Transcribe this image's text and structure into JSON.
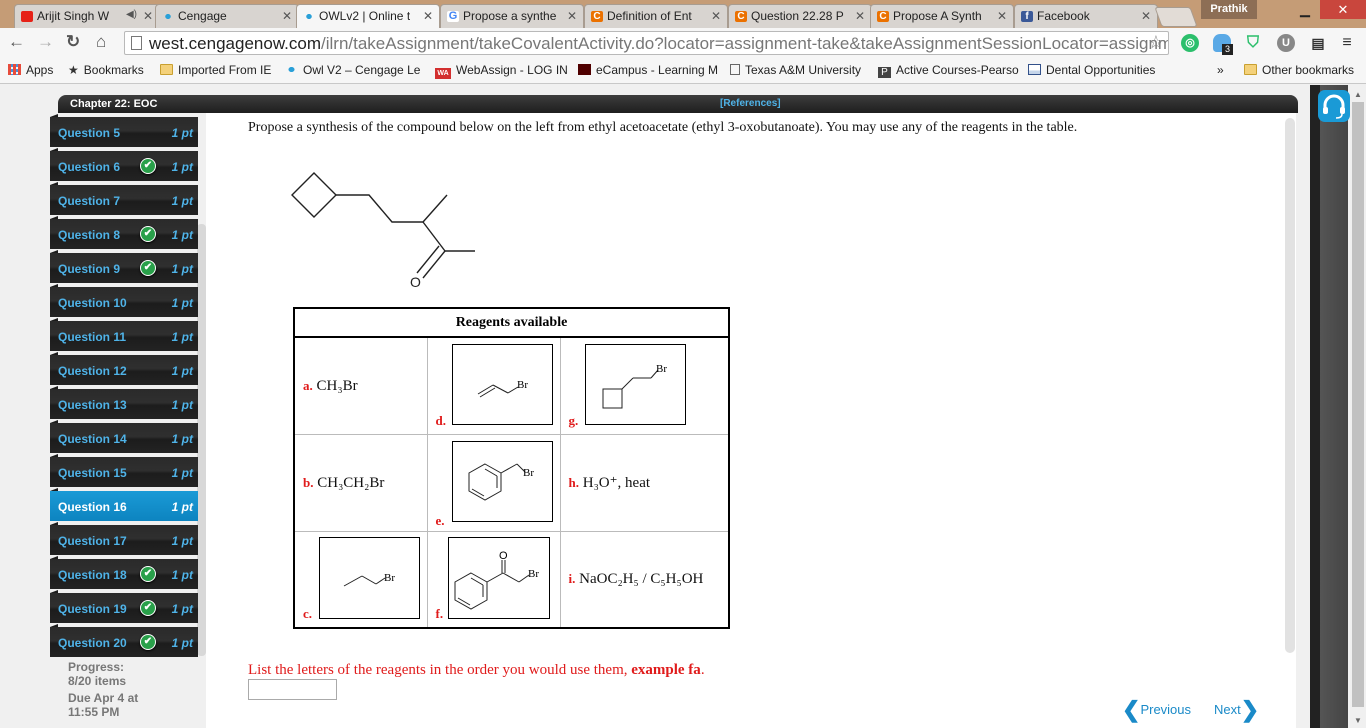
{
  "browser": {
    "tabs": [
      {
        "label": "Arijit Singh W",
        "icon": "youtube-icon",
        "icon_color": "#e62117",
        "audio": true
      },
      {
        "label": "Cengage",
        "icon": "cengage-icon",
        "icon_color": "#2aa0d8"
      },
      {
        "label": "OWLv2 | Online t",
        "icon": "owl-icon",
        "icon_color": "#2aa0d8",
        "active": true
      },
      {
        "label": "Propose a synthe",
        "icon": "google-icon",
        "icon_color": "#4285f4"
      },
      {
        "label": "Definition of Ent",
        "icon": "chegg-icon",
        "icon_color": "#eb7100"
      },
      {
        "label": "Question 22.28 P",
        "icon": "chegg-icon",
        "icon_color": "#eb7100"
      },
      {
        "label": "Propose A Synth",
        "icon": "chegg-icon",
        "icon_color": "#eb7100"
      },
      {
        "label": "Facebook",
        "icon": "facebook-icon",
        "icon_color": "#3b5998"
      }
    ],
    "profile_name": "Prathik",
    "url_host": "west.cengagenow.com",
    "url_path": "/ilrn/takeAssignment/takeCovalentActivity.do?locator=assignment-take&takeAssignmentSessionLocator=assignment-t",
    "extension_badge": "3",
    "bookmarks": [
      {
        "label": "Apps",
        "icon": "apps-icon"
      },
      {
        "label": "Bookmarks",
        "icon": "star-icon"
      },
      {
        "label": "Imported From IE",
        "icon": "folder-icon"
      },
      {
        "label": "Owl V2 – Cengage Le",
        "icon": "owl-icon"
      },
      {
        "label": "WebAssign - LOG IN",
        "icon": "webassign-icon"
      },
      {
        "label": "eCampus - Learning M",
        "icon": "tamu-icon"
      },
      {
        "label": "Texas A&M University",
        "icon": "page-icon"
      },
      {
        "label": "Active Courses-Pearso",
        "icon": "pearson-icon"
      },
      {
        "label": "Dental Opportunities",
        "icon": "page-icon"
      }
    ],
    "overflow": "»",
    "other_bookmarks": "Other bookmarks"
  },
  "assignment": {
    "chapter": "Chapter 22: EOC",
    "references": "[References]",
    "questions": [
      {
        "label": "Question 5",
        "points": "1 pt",
        "done": false
      },
      {
        "label": "Question 6",
        "points": "1 pt",
        "done": true
      },
      {
        "label": "Question 7",
        "points": "1 pt",
        "done": false
      },
      {
        "label": "Question 8",
        "points": "1 pt",
        "done": true
      },
      {
        "label": "Question 9",
        "points": "1 pt",
        "done": true
      },
      {
        "label": "Question 10",
        "points": "1 pt",
        "done": false
      },
      {
        "label": "Question 11",
        "points": "1 pt",
        "done": false
      },
      {
        "label": "Question 12",
        "points": "1 pt",
        "done": false
      },
      {
        "label": "Question 13",
        "points": "1 pt",
        "done": false
      },
      {
        "label": "Question 14",
        "points": "1 pt",
        "done": false
      },
      {
        "label": "Question 15",
        "points": "1 pt",
        "done": false
      },
      {
        "label": "Question 16",
        "points": "1 pt",
        "done": false,
        "active": true
      },
      {
        "label": "Question 17",
        "points": "1 pt",
        "done": false
      },
      {
        "label": "Question 18",
        "points": "1 pt",
        "done": true
      },
      {
        "label": "Question 19",
        "points": "1 pt",
        "done": true
      },
      {
        "label": "Question 20",
        "points": "1 pt",
        "done": true
      }
    ],
    "progress_label": "Progress:",
    "progress_value": "8/20 items",
    "due_line1": "Due Apr 4 at",
    "due_line2": "11:55 PM"
  },
  "question": {
    "prompt": "Propose a synthesis of the compound below on the left from ethyl acetoacetate (ethyl 3-oxobutanoate). You may use any of the reagents in the table.",
    "target_oxygen": "O",
    "table_title": "Reagents available",
    "reagents": {
      "a": {
        "letter": "a.",
        "formula": "CH₃Br"
      },
      "b": {
        "letter": "b.",
        "formula": "CH₃CH₂Br"
      },
      "c": {
        "letter": "c.",
        "structure": "1-bromopropane",
        "br": "Br"
      },
      "d": {
        "letter": "d.",
        "structure": "allyl bromide",
        "br": "Br"
      },
      "e": {
        "letter": "e.",
        "structure": "benzyl bromide",
        "br": "Br"
      },
      "f": {
        "letter": "f.",
        "structure": "2-bromoacetophenone",
        "br": "Br",
        "o": "O"
      },
      "g": {
        "letter": "g.",
        "structure": "(2-bromoethyl)cyclobutane",
        "br": "Br"
      },
      "h": {
        "letter": "h.",
        "formula": "H₃O⁺, heat"
      },
      "i": {
        "letter": "i.",
        "formula": "NaOC₂H₅ / C₅H₅OH"
      }
    },
    "instruction": "List the letters of the reagents in the order you would use them, ",
    "instruction_example": "example fa",
    "instruction_end": ".",
    "answer_value": ""
  },
  "navigation": {
    "previous": "Previous",
    "next": "Next"
  }
}
